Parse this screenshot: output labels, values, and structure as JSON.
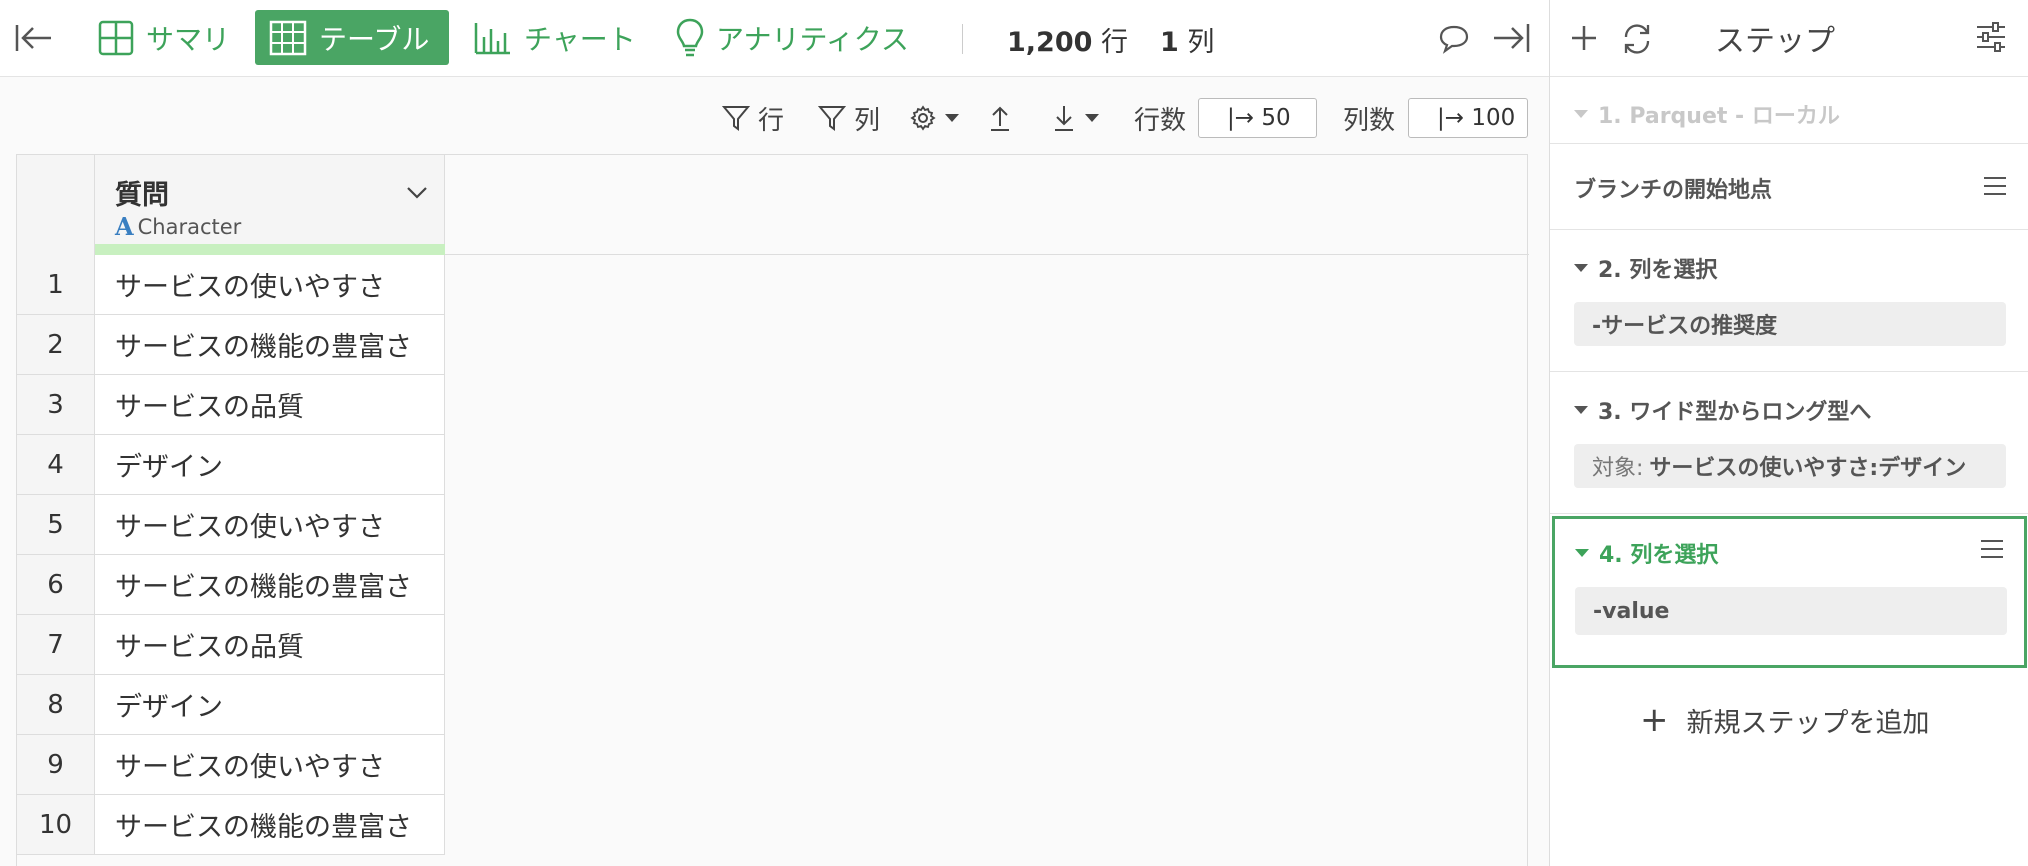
{
  "tabs": [
    {
      "label": "サマリ",
      "active": false
    },
    {
      "label": "テーブル",
      "active": true
    },
    {
      "label": "チャート",
      "active": false
    },
    {
      "label": "アナリティクス",
      "active": false
    }
  ],
  "counts": {
    "rows_value": "1,200",
    "rows_unit": "行",
    "cols_value": "1",
    "cols_unit": "列"
  },
  "toolbar": {
    "filter_rows": "行",
    "filter_cols": "列",
    "row_limit_label": "行数",
    "row_limit_value": "|→ 50",
    "col_limit_label": "列数",
    "col_limit_value": "|→ 100"
  },
  "table": {
    "column": {
      "name": "質問",
      "type": "Character",
      "type_icon": "A"
    },
    "rows": [
      {
        "n": "1",
        "v": "サービスの使いやすさ"
      },
      {
        "n": "2",
        "v": "サービスの機能の豊富さ"
      },
      {
        "n": "3",
        "v": "サービスの品質"
      },
      {
        "n": "4",
        "v": "デザイン"
      },
      {
        "n": "5",
        "v": "サービスの使いやすさ"
      },
      {
        "n": "6",
        "v": "サービスの機能の豊富さ"
      },
      {
        "n": "7",
        "v": "サービスの品質"
      },
      {
        "n": "8",
        "v": "デザイン"
      },
      {
        "n": "9",
        "v": "サービスの使いやすさ"
      },
      {
        "n": "10",
        "v": "サービスの機能の豊富さ"
      }
    ]
  },
  "panel": {
    "title": "ステップ",
    "steps": [
      {
        "title": "1. Parquet - ローカル"
      },
      {
        "title": "ブランチの開始地点"
      },
      {
        "title": "2. 列を選択",
        "detail": "-サービスの推奨度"
      },
      {
        "title": "3. ワイド型からロング型へ",
        "detail_prefix": "対象:",
        "detail": "サービスの使いやすさ:デザイン"
      },
      {
        "title": "4. 列を選択",
        "detail": "-value"
      }
    ],
    "add_step": "新規ステップを追加"
  },
  "colors": {
    "accent": "#4aa564",
    "type_bar": "#c8f0c0",
    "type_icon": "#3a7fc1"
  }
}
